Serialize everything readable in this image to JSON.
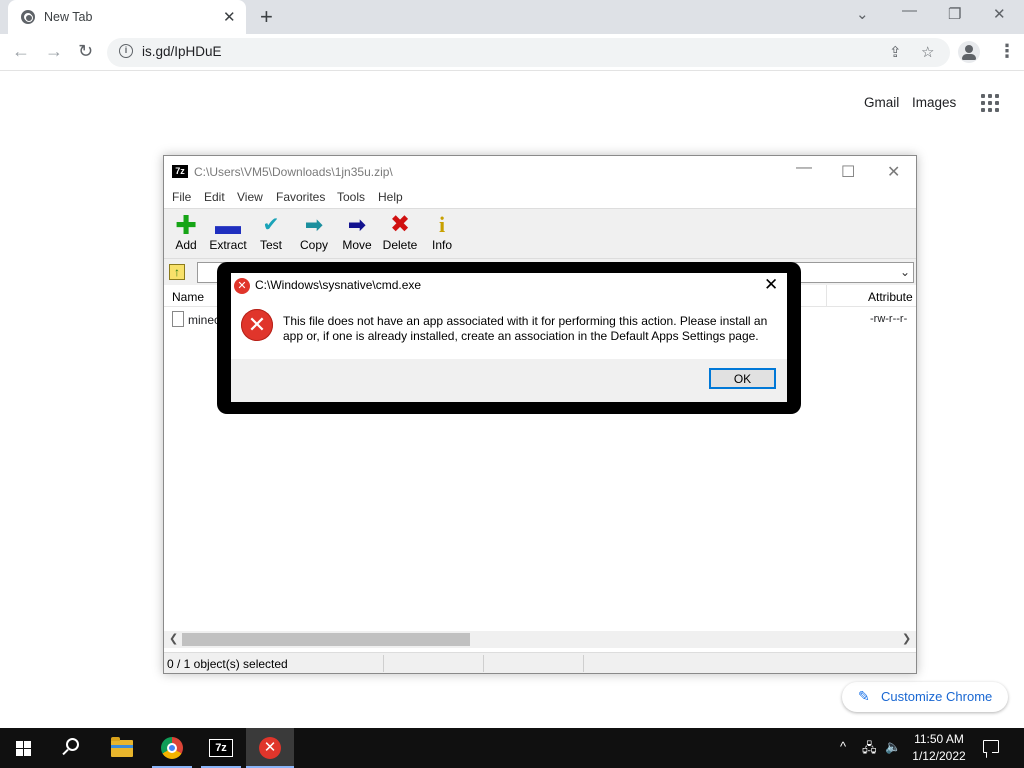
{
  "browser": {
    "tab_title": "New Tab",
    "url": "is.gd/IpHDuE",
    "links": {
      "gmail": "Gmail",
      "images": "Images"
    },
    "customize_label": "Customize Chrome"
  },
  "sevenzip": {
    "title": "C:\\Users\\VM5\\Downloads\\1jn35u.zip\\",
    "menu": [
      "File",
      "Edit",
      "View",
      "Favorites",
      "Tools",
      "Help"
    ],
    "toolbar": [
      {
        "label": "Add",
        "icon": "plus-icon",
        "color": "#16a516"
      },
      {
        "label": "Extract",
        "icon": "minus-icon",
        "color": "#1f2fbf"
      },
      {
        "label": "Test",
        "icon": "check-icon",
        "color": "#1aa3b8"
      },
      {
        "label": "Copy",
        "icon": "arrow-right-icon",
        "color": "#1b8f9e"
      },
      {
        "label": "Move",
        "icon": "arrow-right-icon",
        "color": "#12128f"
      },
      {
        "label": "Delete",
        "icon": "x-icon",
        "color": "#d01010"
      },
      {
        "label": "Info",
        "icon": "info-icon",
        "color": "#c8a000"
      }
    ],
    "columns": {
      "name": "Name",
      "attributes": "Attribute"
    },
    "files": [
      {
        "name": "minec",
        "attributes": "-rw-r--r-"
      }
    ],
    "status": "0 / 1 object(s) selected"
  },
  "dialog": {
    "title": "C:\\Windows\\sysnative\\cmd.exe",
    "message": "This file does not have an app associated with it for performing this action. Please install an app or, if one is already installed, create an association in the Default Apps Settings page.",
    "ok_label": "OK"
  },
  "taskbar": {
    "time": "11:50 AM",
    "date": "1/12/2022",
    "sevenzip_label": "7z"
  }
}
